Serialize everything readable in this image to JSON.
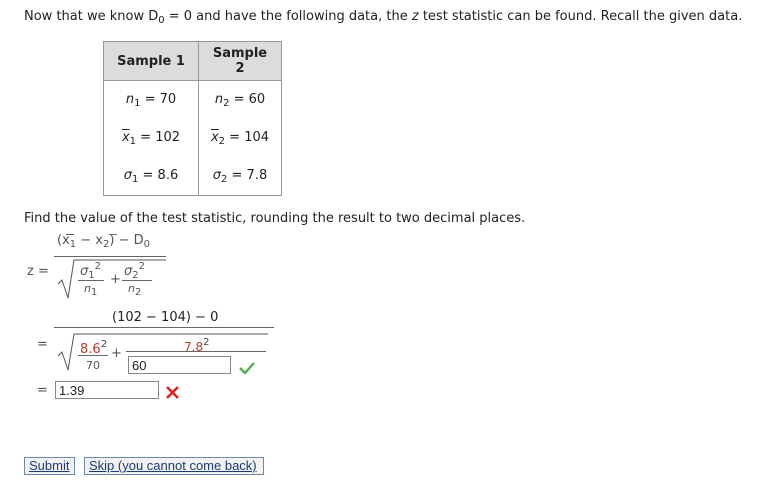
{
  "intro": {
    "p1": "Now that we know D",
    "p1_sub": "0",
    "p2": " = 0 and have the following data, the ",
    "p2_z": "z",
    "p3": " test statistic can be found. Recall the given data."
  },
  "table": {
    "headers": [
      "Sample 1",
      "Sample 2"
    ],
    "rows": [
      [
        {
          "sym": "n",
          "sub": "1",
          "val": " = 70"
        },
        {
          "sym": "n",
          "sub": "2",
          "val": " = 60"
        }
      ],
      [
        {
          "sym": "x",
          "sub": "1",
          "val": " = 102"
        },
        {
          "sym": "x",
          "sub": "2",
          "val": " = 104"
        }
      ],
      [
        {
          "sym": "σ",
          "sub": "1",
          "val": " = 8.6"
        },
        {
          "sym": "σ",
          "sub": "2",
          "val": " = 7.8"
        }
      ]
    ]
  },
  "find_text": "Find the value of the test statistic, rounding the result to two decimal places.",
  "formula": {
    "z_label": "z =",
    "num_open": "(x",
    "num_sub1": "1",
    "num_minus": " − x",
    "num_sub2": "2",
    "num_close": ") − D",
    "num_sub0": "0",
    "sigma": "σ",
    "sub1": "1",
    "sub2": "2",
    "exp": "2",
    "n": "n",
    "plus": "+",
    "eq": "="
  },
  "step2": {
    "numerator": "(102 − 104) − 0",
    "sigma1_sq": "8.6",
    "exp": "2",
    "n1": "70",
    "sigma2_sq": "7.8",
    "n2_value": "60",
    "plus": "+",
    "eq": "="
  },
  "result": {
    "eq": "=",
    "value": "1.39"
  },
  "buttons": {
    "submit": "Submit",
    "skip": "Skip (you cannot come back)"
  }
}
